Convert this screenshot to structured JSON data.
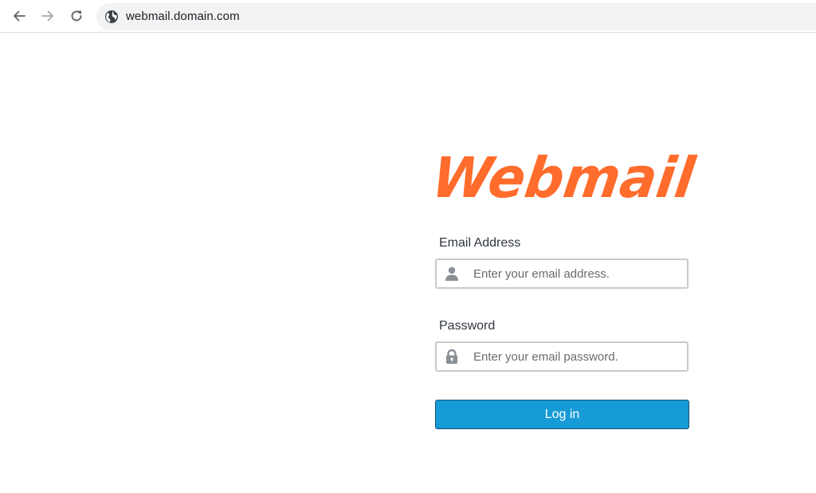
{
  "browser": {
    "url": "webmail.domain.com",
    "icons": {
      "back": "arrow-left-icon",
      "forward": "arrow-right-icon",
      "reload": "reload-icon",
      "site": "globe-icon"
    }
  },
  "logo": {
    "text": "Webmail",
    "color": "#ff6c2c"
  },
  "form": {
    "email": {
      "label": "Email Address",
      "placeholder": "Enter your email address.",
      "value": "",
      "icon": "user-icon"
    },
    "password": {
      "label": "Password",
      "placeholder": "Enter your email password.",
      "value": "",
      "icon": "lock-icon"
    },
    "submit_label": "Log in"
  },
  "colors": {
    "accent": "#179bd7",
    "button_border": "#1a4f73",
    "logo": "#ff6c2c"
  }
}
